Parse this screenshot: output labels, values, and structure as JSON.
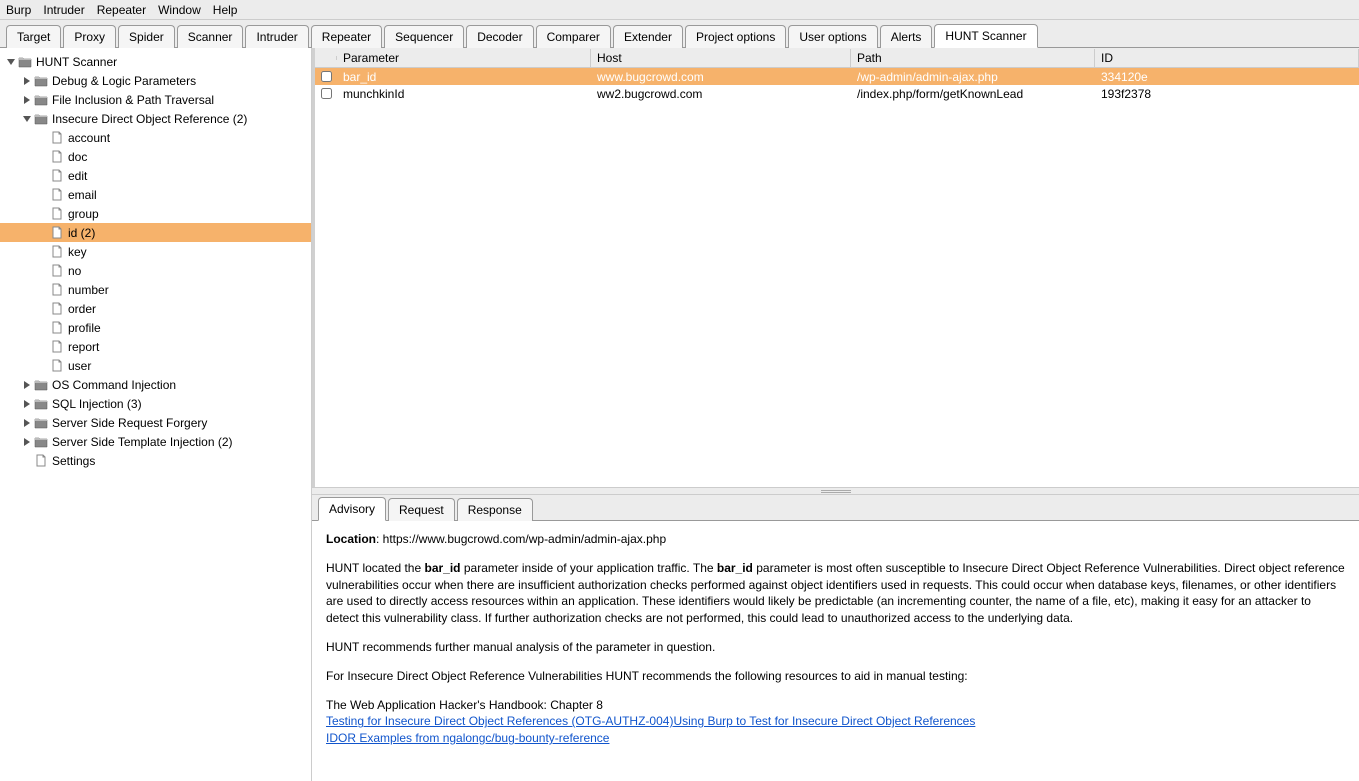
{
  "menubar": [
    "Burp",
    "Intruder",
    "Repeater",
    "Window",
    "Help"
  ],
  "tabs": [
    "Target",
    "Proxy",
    "Spider",
    "Scanner",
    "Intruder",
    "Repeater",
    "Sequencer",
    "Decoder",
    "Comparer",
    "Extender",
    "Project options",
    "User options",
    "Alerts",
    "HUNT Scanner"
  ],
  "active_tab": "HUNT Scanner",
  "tree": [
    {
      "depth": 0,
      "toggle": "open",
      "icon": "folder",
      "label": "HUNT Scanner"
    },
    {
      "depth": 1,
      "toggle": "closed",
      "icon": "folder",
      "label": "Debug & Logic Parameters"
    },
    {
      "depth": 1,
      "toggle": "closed",
      "icon": "folder",
      "label": "File Inclusion & Path Traversal"
    },
    {
      "depth": 1,
      "toggle": "open",
      "icon": "folder",
      "label": "Insecure Direct Object Reference (2)"
    },
    {
      "depth": 2,
      "toggle": "none",
      "icon": "file",
      "label": "account"
    },
    {
      "depth": 2,
      "toggle": "none",
      "icon": "file",
      "label": "doc"
    },
    {
      "depth": 2,
      "toggle": "none",
      "icon": "file",
      "label": "edit"
    },
    {
      "depth": 2,
      "toggle": "none",
      "icon": "file",
      "label": "email"
    },
    {
      "depth": 2,
      "toggle": "none",
      "icon": "file",
      "label": "group"
    },
    {
      "depth": 2,
      "toggle": "none",
      "icon": "file",
      "label": "id (2)",
      "selected": true
    },
    {
      "depth": 2,
      "toggle": "none",
      "icon": "file",
      "label": "key"
    },
    {
      "depth": 2,
      "toggle": "none",
      "icon": "file",
      "label": "no"
    },
    {
      "depth": 2,
      "toggle": "none",
      "icon": "file",
      "label": "number"
    },
    {
      "depth": 2,
      "toggle": "none",
      "icon": "file",
      "label": "order"
    },
    {
      "depth": 2,
      "toggle": "none",
      "icon": "file",
      "label": "profile"
    },
    {
      "depth": 2,
      "toggle": "none",
      "icon": "file",
      "label": "report"
    },
    {
      "depth": 2,
      "toggle": "none",
      "icon": "file",
      "label": "user"
    },
    {
      "depth": 1,
      "toggle": "closed",
      "icon": "folder",
      "label": "OS Command Injection"
    },
    {
      "depth": 1,
      "toggle": "closed",
      "icon": "folder",
      "label": "SQL Injection (3)"
    },
    {
      "depth": 1,
      "toggle": "closed",
      "icon": "folder",
      "label": "Server Side Request Forgery"
    },
    {
      "depth": 1,
      "toggle": "closed",
      "icon": "folder",
      "label": "Server Side Template Injection (2)"
    },
    {
      "depth": 1,
      "toggle": "none",
      "icon": "file",
      "label": "Settings"
    }
  ],
  "table": {
    "headers": {
      "param": "Parameter",
      "host": "Host",
      "path": "Path",
      "id": "ID"
    },
    "rows": [
      {
        "param": "bar_id",
        "host": "www.bugcrowd.com",
        "path": "/wp-admin/admin-ajax.php",
        "id": "334120e",
        "selected": true
      },
      {
        "param": "munchkinId",
        "host": "ww2.bugcrowd.com",
        "path": "/index.php/form/getKnownLead",
        "id": "193f2378"
      }
    ]
  },
  "detail_tabs": [
    "Advisory",
    "Request",
    "Response"
  ],
  "active_detail_tab": "Advisory",
  "advisory": {
    "location_label": "Location",
    "location_value": ": https://www.bugcrowd.com/wp-admin/admin-ajax.php",
    "p1a": "HUNT located the ",
    "p1b": "bar_id",
    "p1c": " parameter inside of your application traffic. The ",
    "p1d": "bar_id",
    "p1e": " parameter is most often susceptible to Insecure Direct Object Reference Vulnerabilities. Direct object reference vulnerabilities occur when there are insufficient authorization checks performed against object identifiers used in requests. This could occur when database keys, filenames, or other identifiers are used to directly access resources within an application. These identifiers would likely be predictable (an incrementing counter, the name of a file, etc), making it easy for an attacker to detect this vulnerability class. If further authorization checks are not performed, this could lead to unauthorized access to the underlying data.",
    "p2": "HUNT recommends further manual analysis of the parameter in question.",
    "p3": "For Insecure Direct Object Reference Vulnerabilities HUNT recommends the following resources to aid in manual testing:",
    "p4": "The Web Application Hacker's Handbook: Chapter 8",
    "link1": "Testing for Insecure Direct Object References (OTG-AUTHZ-004)",
    "link2": "Using Burp to Test for Insecure Direct Object References",
    "link3": "IDOR Examples from ngalongc/bug-bounty-reference"
  }
}
